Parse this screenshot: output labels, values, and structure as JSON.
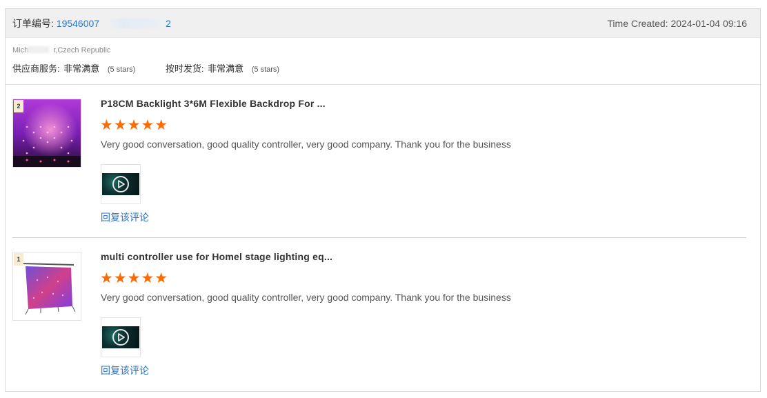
{
  "header": {
    "order_label": "订单编号: ",
    "order_number": "19546007",
    "order_number_tail": "2",
    "time_created": "Time Created: 2024-01-04 09:16"
  },
  "buyer": {
    "name_prefix": "Mich",
    "name_suffix": "r,Czech Republic",
    "supplier_service_label": "供应商服务:",
    "supplier_service_value": "非常满意",
    "supplier_service_stars": "(5 stars)",
    "on_time_label": "按时发货:",
    "on_time_value": "非常满意",
    "on_time_stars": "(5 stars)"
  },
  "reviews": [
    {
      "index": "2",
      "product_title": "P18CM Backlight 3*6M Flexible Backdrop For ...",
      "stars": "★★★★★",
      "rating": 5,
      "text": "Very good conversation, good quality controller, very good company. Thank you for the business",
      "reply_label": "回复该评论"
    },
    {
      "index": "1",
      "product_title": "multi controller use for Homel stage lighting eq...",
      "stars": "★★★★★",
      "rating": 5,
      "text": "Very good conversation, good quality controller, very good company. Thank you for the business",
      "reply_label": "回复该评论"
    }
  ],
  "colors": {
    "accent_link": "#2a73c5",
    "star": "#ff6a00",
    "header_bg": "#f0f0f0"
  }
}
